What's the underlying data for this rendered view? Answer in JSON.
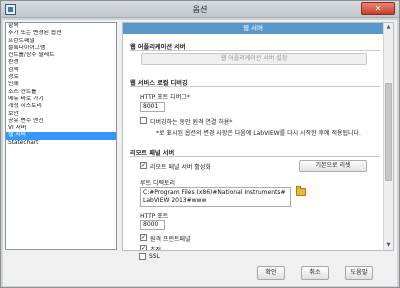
{
  "window": {
    "title": "옵션"
  },
  "categories": [
    "항목",
    "추가 또는 변경된 옵션",
    "프런트패널",
    "블록다이어그램",
    "컨트롤/함수 팔레트",
    "환경",
    "검색",
    "경로",
    "인쇄",
    "소스 컨트롤",
    "메뉴 바로 가기",
    "개정 히스토리",
    "보안",
    "공유 변수 엔진",
    "VI 서버",
    "웹 서버",
    "Statechart"
  ],
  "selected_category": "웹 서버",
  "panel": {
    "header": "웹 서버",
    "app_server": {
      "title": "웹 어플리케이션 서버",
      "config_button": "웹 어플리케이션 서버 설정"
    },
    "local_debug": {
      "title": "웹 서비스 로컬 디버깅",
      "http_port_label": "HTTP 포트 디버그*",
      "http_port_value": "8001",
      "remote_debug_label": "디버깅하는 동안 원격 연결 허용*",
      "remote_debug_checked": false,
      "note": "*로 표시된 옵션의 변경 사항은 다음에 LabVIEW를 다시 시작한 후에 적용됩니다."
    },
    "remote_panel": {
      "title": "리모트 패널 서버",
      "enable_label": "리모트 패널 서버 활성화",
      "enable_checked": true,
      "restore_defaults_button": "기본으로 리셋",
      "root_dir_label": "루트 디렉토리",
      "root_dir_line1": "C:#Program Files (x86)#National Instruments#",
      "root_dir_line2": "LabVIEW 2013#www",
      "http_port_label": "HTTP 포트",
      "http_port_value": "8000",
      "remote_fp_label": "원격 프런트패널",
      "remote_fp_checked": true,
      "tracing_label": "추적",
      "tracing_checked": true,
      "ssl_label": "SSL",
      "ssl_checked": false
    }
  },
  "footer": {
    "ok": "확인",
    "cancel": "취소",
    "help": "도움말"
  },
  "colors": {
    "header_blue": "#5797c9",
    "selection_blue": "#3399ff",
    "close_red": "#c63f2c"
  }
}
